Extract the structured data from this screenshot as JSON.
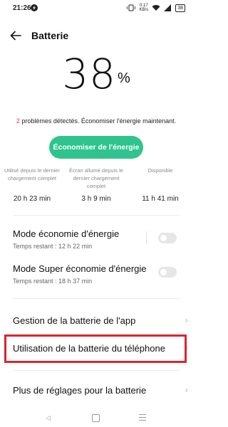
{
  "status_bar": {
    "time": "21:26",
    "net_speed_value": "0.17",
    "net_speed_unit": "KB/s",
    "battery_level": "38"
  },
  "header": {
    "title": "Batterie"
  },
  "battery": {
    "percent": "38",
    "percent_symbol": "%"
  },
  "problems": {
    "count": "2",
    "text": " problèmes détectés. Économiser l'énergie maintenant."
  },
  "eco_button_label": "Économiser de l'énergie",
  "stats": [
    {
      "label": "Utilisé depuis le dernier chargement complet",
      "value": "20 h 23 min"
    },
    {
      "label": "Écran allumé depuis le dernier chargement complet",
      "value": "3 h 9 min"
    },
    {
      "label": "Disponible",
      "value": "11 h 41 min"
    }
  ],
  "power_saving": {
    "title": "Mode économie d'énergie",
    "sub_label": "Temps restant :",
    "sub_value": "12 h 22 min"
  },
  "super_saving": {
    "title": "Mode Super économie d'énergie",
    "sub_label": "Temps restant :",
    "sub_value": "18 h 37 min"
  },
  "menu": {
    "app_usage": "Gestion de la batterie de l'app",
    "phone_usage": "Utilisation de la batterie du téléphone",
    "more_settings": "Plus de réglages pour la batterie"
  },
  "colors": {
    "accent_green": "#2fc48d",
    "problem_red": "#e53935",
    "highlight_red": "#d9262f"
  },
  "icons": [
    "back-arrow-icon",
    "chevron-right-icon",
    "wifi-icon",
    "signal-icon",
    "battery-icon",
    "vibrate-icon",
    "nav-back-icon",
    "nav-home-icon",
    "nav-menu-icon"
  ]
}
